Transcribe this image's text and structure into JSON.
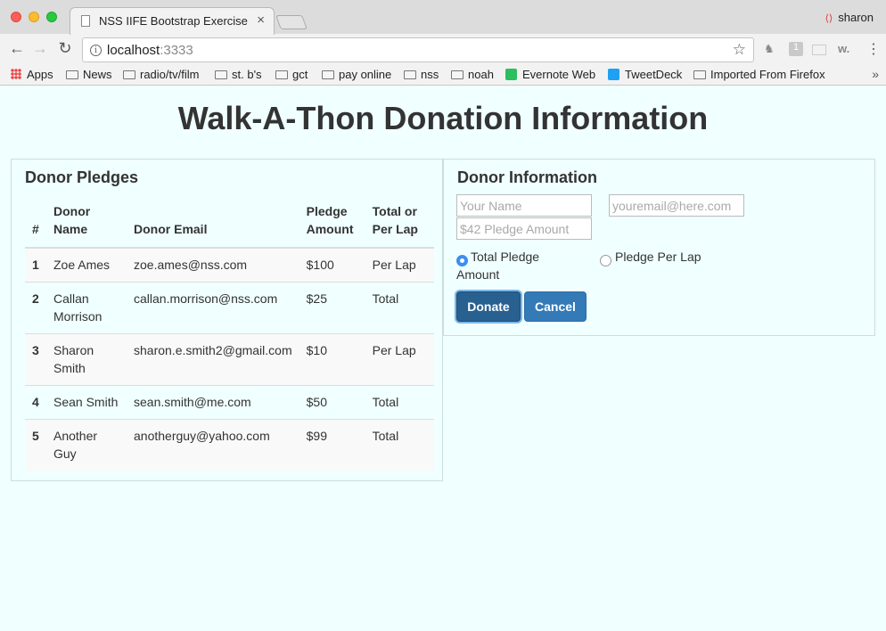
{
  "browser": {
    "tab_title": "NSS IIFE Bootstrap Exercise",
    "tab_close": "×",
    "profile_name": "sharon",
    "url_host": "localhost",
    "url_port": ":3333",
    "bookmarks": [
      "Apps",
      "News",
      "radio/tv/film",
      "st. b's",
      "gct",
      "pay online",
      "nss",
      "noah",
      "Evernote Web",
      "TweetDeck",
      "Imported From Firefox"
    ],
    "more": "»"
  },
  "page": {
    "title": "Walk-A-Thon Donation Information"
  },
  "pledges": {
    "heading": "Donor Pledges",
    "columns": [
      "#",
      "Donor Name",
      "Donor Email",
      "Pledge Amount",
      "Total or Per Lap"
    ],
    "rows": [
      {
        "num": "1",
        "name": "Zoe Ames",
        "email": "zoe.ames@nss.com",
        "amount": "$100",
        "type": "Per Lap"
      },
      {
        "num": "2",
        "name": "Callan Morrison",
        "email": "callan.morrison@nss.com",
        "amount": "$25",
        "type": "Total"
      },
      {
        "num": "3",
        "name": "Sharon Smith",
        "email": "sharon.e.smith2@gmail.com",
        "amount": "$10",
        "type": "Per Lap"
      },
      {
        "num": "4",
        "name": "Sean Smith",
        "email": "sean.smith@me.com",
        "amount": "$50",
        "type": "Total"
      },
      {
        "num": "5",
        "name": "Another Guy",
        "email": "anotherguy@yahoo.com",
        "amount": "$99",
        "type": "Total"
      }
    ]
  },
  "donor_form": {
    "heading": "Donor Information",
    "name_placeholder": "Your Name",
    "email_placeholder": "youremail@here.com",
    "amount_placeholder": "$42 Pledge Amount",
    "radio_total_line1": "Total Pledge",
    "radio_total_line2": "Amount",
    "radio_per_lap": "Pledge Per Lap",
    "donate_label": "Donate",
    "cancel_label": "Cancel"
  }
}
